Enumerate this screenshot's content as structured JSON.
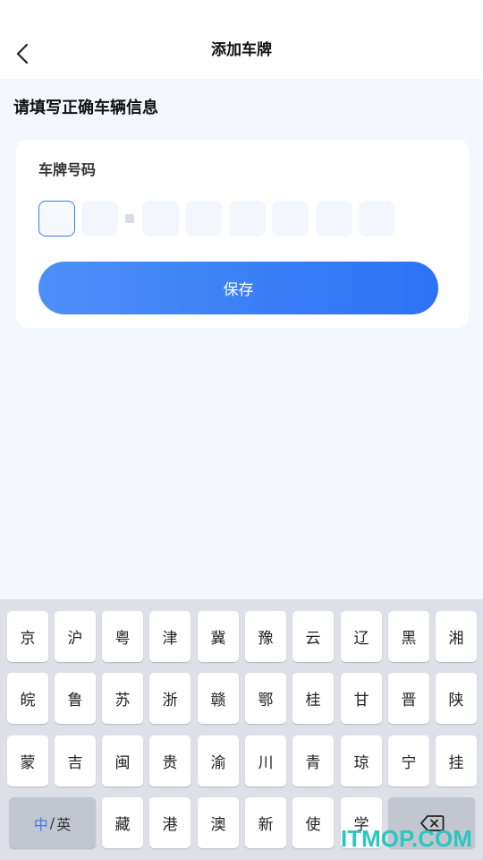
{
  "header": {
    "title": "添加车牌",
    "back_icon": "chevron-left-icon"
  },
  "section_title": "请填写正确车辆信息",
  "card": {
    "label": "车牌号码",
    "plate_slots": [
      "",
      "",
      "",
      "",
      "",
      "",
      "",
      ""
    ],
    "save_label": "保存"
  },
  "keyboard": {
    "row1": [
      "京",
      "沪",
      "粤",
      "津",
      "冀",
      "豫",
      "云",
      "辽",
      "黑",
      "湘"
    ],
    "row2": [
      "皖",
      "鲁",
      "苏",
      "浙",
      "赣",
      "鄂",
      "桂",
      "甘",
      "晋",
      "陕"
    ],
    "row3": [
      "蒙",
      "吉",
      "闽",
      "贵",
      "渝",
      "川",
      "青",
      "琼",
      "宁",
      "挂"
    ],
    "row4": [
      "藏",
      "港",
      "澳",
      "新",
      "使",
      "学"
    ],
    "lang_toggle": {
      "a": "中",
      "sep": "/",
      "b": "英"
    },
    "delete_icon": "backspace-icon"
  },
  "watermark": "ITMOP.COM",
  "colors": {
    "accent": "#3a7cf5",
    "background": "#f3f6fd",
    "keyboard_bg": "#dde0e6",
    "watermark": "#2cc6c0"
  }
}
